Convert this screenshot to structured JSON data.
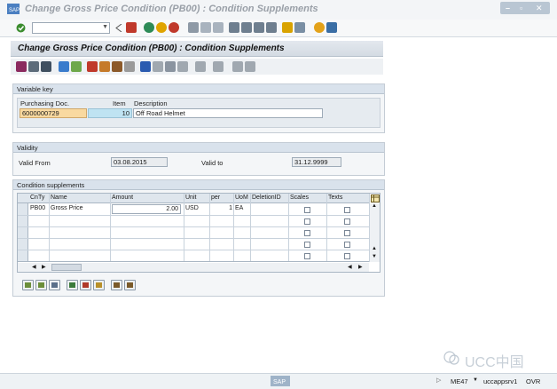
{
  "window": {
    "title": "Change Gross Price Condition (PB00) : Condition Supplements"
  },
  "screen": {
    "title": "Change Gross Price Condition (PB00) : Condition Supplements"
  },
  "variable_key": {
    "frame_title": "Variable key",
    "headers": {
      "purchasing_doc": "Purchasing Doc.",
      "item": "Item",
      "description": "Description"
    },
    "row": {
      "purchasing_doc": "6000000729",
      "item": "10",
      "description": "Off Road Helmet"
    }
  },
  "validity": {
    "frame_title": "Validity",
    "valid_from_label": "Valid From",
    "valid_from_value": "03.08.2015",
    "valid_to_label": "Valid to",
    "valid_to_value": "31.12.9999"
  },
  "supplements": {
    "frame_title": "Condition supplements",
    "columns": [
      "CnTy",
      "Name",
      "Amount",
      "Unit",
      "per",
      "UoM",
      "DeletionID",
      "Scales",
      "Texts"
    ],
    "row": {
      "cnty": "PB00",
      "name": "Gross Price",
      "amount": "2.00",
      "unit": "USD",
      "per": "1",
      "uom": "EA"
    }
  },
  "status": {
    "transaction": "ME47",
    "server": "uccappsrv1",
    "mode": "OVR",
    "watermark": "UCC中国"
  },
  "colors": {
    "accent_blue": "#4a7fc1",
    "highlight_orange": "#f9d9a0",
    "highlight_blue": "#bfe3f2"
  }
}
